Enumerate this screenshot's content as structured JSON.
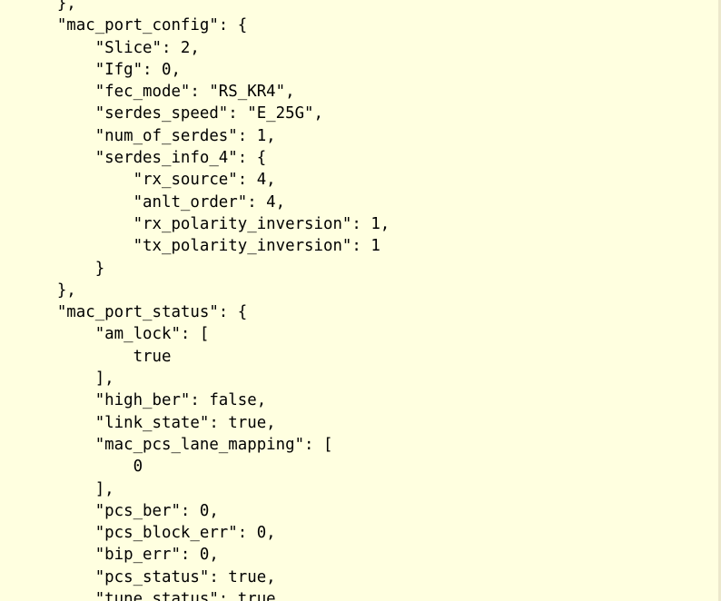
{
  "document": {
    "lines": [
      "      },",
      "      \"mac_port_config\": {",
      "          \"Slice\": 2,",
      "          \"Ifg\": 0,",
      "          \"fec_mode\": \"RS_KR4\",",
      "          \"serdes_speed\": \"E_25G\",",
      "          \"num_of_serdes\": 1,",
      "          \"serdes_info_4\": {",
      "              \"rx_source\": 4,",
      "              \"anlt_order\": 4,",
      "              \"rx_polarity_inversion\": 1,",
      "              \"tx_polarity_inversion\": 1",
      "          }",
      "      },",
      "      \"mac_port_status\": {",
      "          \"am_lock\": [",
      "              true",
      "          ],",
      "          \"high_ber\": false,",
      "          \"link_state\": true,",
      "          \"mac_pcs_lane_mapping\": [",
      "              0",
      "          ],",
      "          \"pcs_ber\": 0,",
      "          \"pcs_block_err\": 0,",
      "          \"bip_err\": 0,",
      "          \"pcs_status\": true,",
      "          \"tune_status\": true"
    ]
  },
  "colors": {
    "background": "#ffffe0",
    "text": "#000000"
  }
}
